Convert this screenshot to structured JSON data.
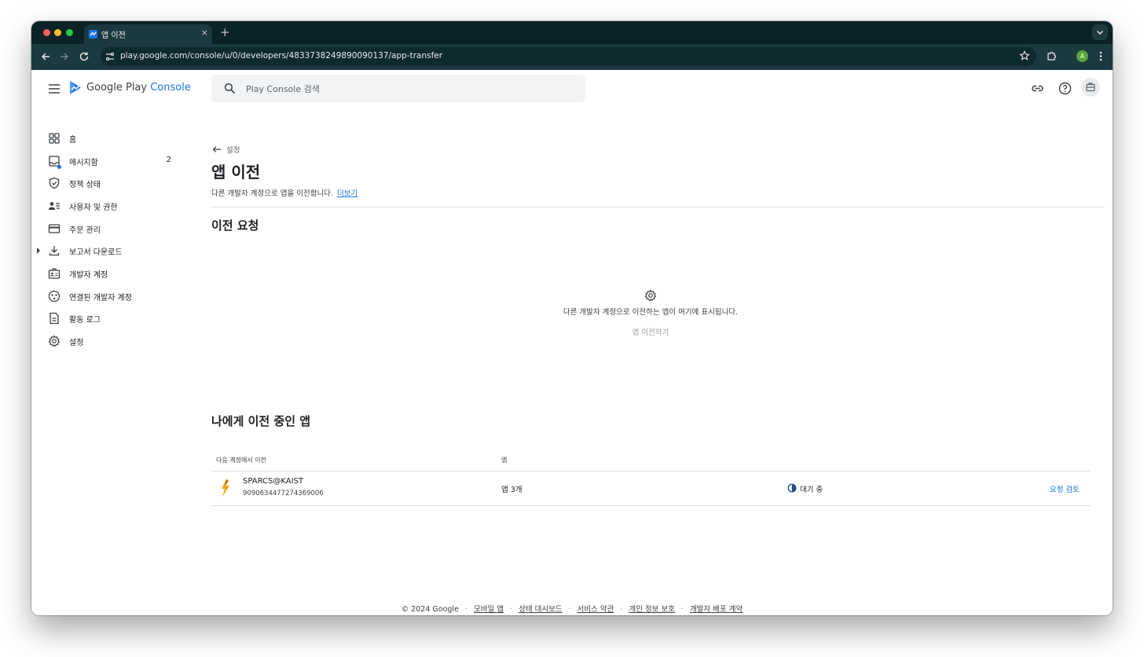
{
  "browser": {
    "tab_title": "앱 이전",
    "tab_close": "×",
    "new_tab": "+",
    "url": "play.google.com/console/u/0/developers/4833738249890090137/app-transfer",
    "profile_initial": "A"
  },
  "header": {
    "brand_prefix": "Google Play ",
    "brand_accent": "Console",
    "search_placeholder": "Play Console 검색",
    "accent_color": "#1a73e8"
  },
  "sidebar": {
    "items": [
      {
        "label": "홈",
        "icon": "grid-icon"
      },
      {
        "label": "메시지함",
        "icon": "inbox-icon",
        "badge": "2"
      },
      {
        "label": "정책 상태",
        "icon": "shield-icon"
      },
      {
        "label": "사용자 및 권한",
        "icon": "people-icon"
      },
      {
        "label": "주문 관리",
        "icon": "credit-card-icon"
      },
      {
        "label": "보고서 다운로드",
        "icon": "download-icon"
      },
      {
        "label": "개발자 계정",
        "icon": "badge-icon"
      },
      {
        "label": "연결된 개발자 계정",
        "icon": "linked-accounts-icon"
      },
      {
        "label": "활동 로그",
        "icon": "document-icon"
      },
      {
        "label": "설정",
        "icon": "gear-icon"
      }
    ]
  },
  "main": {
    "back_label": "설정",
    "title": "앱 이전",
    "subtitle": "다른 개발자 계정으로 앱을 이전합니다.",
    "learn_more": "더보기",
    "outgoing": {
      "title": "이전 요청",
      "empty_text": "다른 개발자 계정으로 이전하는 앱이 여기에 표시됩니다.",
      "action": "앱 이전하기"
    },
    "incoming": {
      "title": "나에게 이전 중인 앱",
      "columns": [
        "다음 계정에서 이전",
        "앱"
      ],
      "rows": [
        {
          "account_name": "SPARCS@KAIST",
          "account_id": "9090634477274369006",
          "apps": "앱 3개",
          "status": "대기 중",
          "action": "요청 검토"
        }
      ]
    }
  },
  "footer": {
    "copyright": "© 2024 Google",
    "links": [
      "모바일 앱",
      "상태 대시보드",
      "서비스 약관",
      "개인 정보 보호",
      "개발자 배포 계약"
    ],
    "separator": "·"
  }
}
